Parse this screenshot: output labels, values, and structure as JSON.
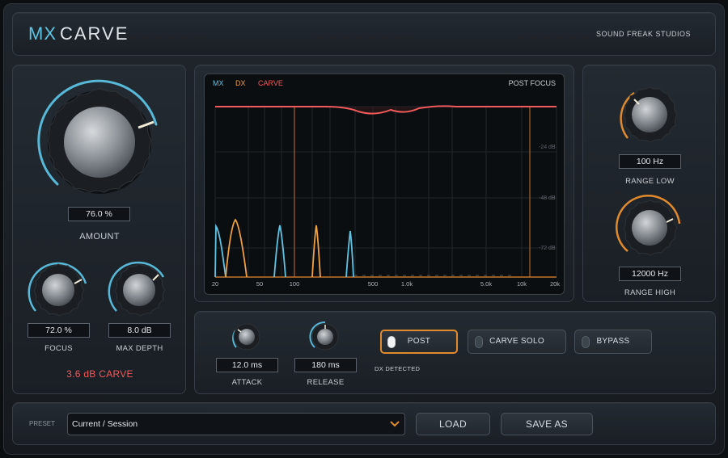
{
  "header": {
    "logo_mx": "MX",
    "logo_carve": "CARVE",
    "vendor": "SOUND FREAK STUDIOS"
  },
  "amount": {
    "value": "76.0 %",
    "label": "AMOUNT",
    "level": 0.76
  },
  "focus": {
    "value": "72.0 %",
    "label": "FOCUS",
    "level": 0.72
  },
  "max_depth": {
    "value": "8.0 dB",
    "label": "MAX DEPTH",
    "level": 0.7
  },
  "carve_readout": "3.6 dB CARVE",
  "range_low": {
    "value": "100 Hz",
    "label": "RANGE LOW",
    "level": 0.45
  },
  "range_high": {
    "value": "12000 Hz",
    "label": "RANGE HIGH",
    "level": 0.8
  },
  "attack": {
    "value": "12.0 ms",
    "label": "ATTACK",
    "level": 0.2
  },
  "release": {
    "value": "180 ms",
    "label": "RELEASE",
    "level": 0.45
  },
  "buttons": {
    "post": "POST",
    "carve_solo": "CARVE SOLO",
    "bypass": "BYPASS",
    "post_active": true
  },
  "dx_detected": "DX DETECTED",
  "display": {
    "legend_mx": "MX",
    "legend_dx": "DX",
    "legend_carve": "CARVE",
    "mode": "POST FOCUS",
    "db_labels": [
      "-24 dB",
      "-48 dB",
      "-72 dB"
    ],
    "freq_labels": [
      "20",
      "50",
      "100",
      "500",
      "1.0k",
      "5.0k",
      "10k",
      "20k"
    ],
    "range_low_hz": 100,
    "range_high_hz": 12000
  },
  "footer": {
    "preset_label": "PRESET",
    "preset_value": "Current / Session",
    "load": "LOAD",
    "save_as": "SAVE AS"
  },
  "colors": {
    "mx": "#5fc3e4",
    "dx": "#f0a040",
    "carve": "#f05a5a",
    "accent_orange": "#e08a2d",
    "accent_blue": "#58b8d8"
  }
}
